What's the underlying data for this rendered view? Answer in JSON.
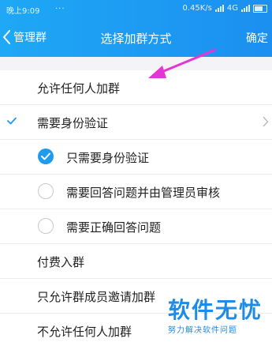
{
  "status_bar": {
    "time": "晚上9:09",
    "dots": "...",
    "speed": "0.45K/s",
    "network": "4G"
  },
  "header": {
    "back_label": "管理群",
    "title": "选择加群方式",
    "confirm_label": "确定"
  },
  "options": {
    "allow_anyone": "允许任何人加群",
    "need_verification": "需要身份验证",
    "sub": {
      "only_verification": "只需要身份验证",
      "answer_and_review": "需要回答问题并由管理员审核",
      "correct_answer": "需要正确回答问题"
    },
    "paid": "付费入群",
    "invite_only": "只允许群成员邀请加群",
    "no_one": "不允许任何人加群"
  },
  "selection": {
    "main": "need_verification",
    "sub": "only_verification"
  },
  "watermark": {
    "title": "软件无忧",
    "subtitle": "努力解决软件问题"
  },
  "colors": {
    "header_start": "#1ea8f5",
    "header_end": "#1c8ff0",
    "accent": "#1e9bf0",
    "annotation_arrow": "#e535d4"
  }
}
